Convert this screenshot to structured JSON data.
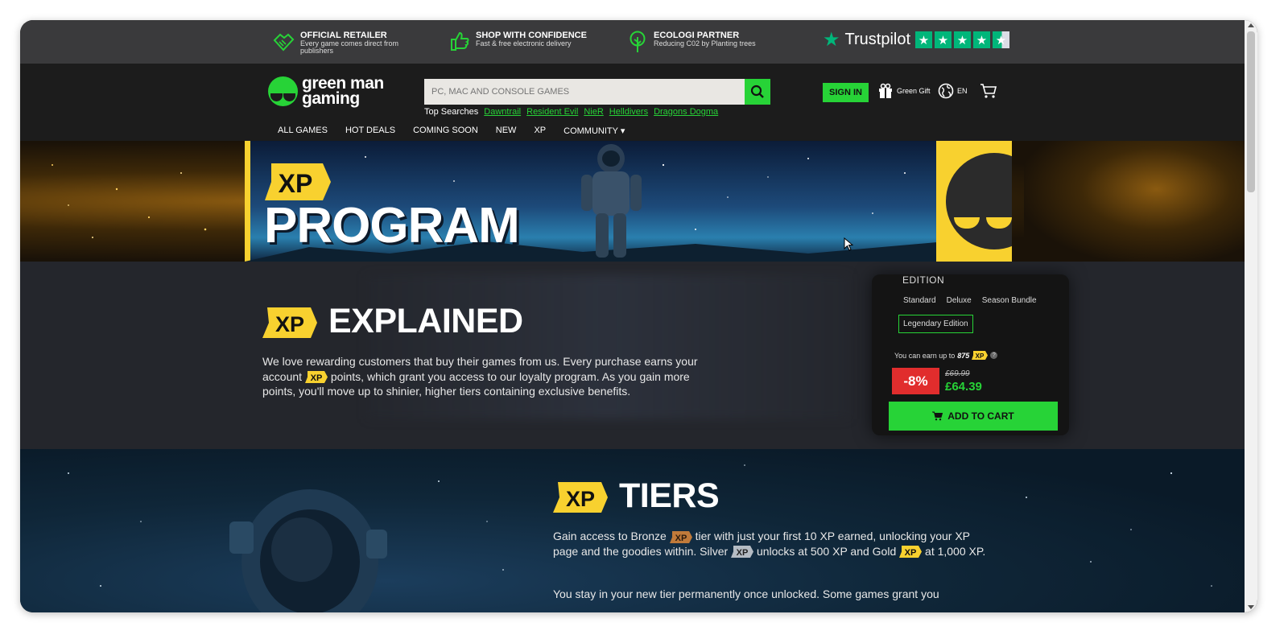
{
  "trustbar": {
    "items": [
      {
        "title": "OFFICIAL RETAILER",
        "sub": "Every game comes direct from publishers",
        "icon": "handshake-icon"
      },
      {
        "title": "SHOP WITH CONFIDENCE",
        "sub": "Fast & free electronic delivery",
        "icon": "thumbs-up-icon"
      },
      {
        "title": "ECOLOGI PARTNER",
        "sub": "Reducing C02 by Planting trees",
        "icon": "tree-icon"
      }
    ],
    "trustpilot": "Trustpilot",
    "trustpilot_rating": 4.5
  },
  "header": {
    "logo_line1": "green man",
    "logo_line2": "gaming",
    "search_placeholder": "PC, MAC AND CONSOLE GAMES",
    "top_searches_label": "Top Searches",
    "top_searches": [
      "Dawntrail",
      "Resident Evil",
      "NieR",
      "Helldivers",
      "Dragons Dogma"
    ],
    "signin": "SIGN IN",
    "green_gift": "Green Gift",
    "language": "EN"
  },
  "nav": [
    "ALL GAMES",
    "HOT DEALS",
    "COMING SOON",
    "NEW",
    "XP",
    "COMMUNITY ▾"
  ],
  "hero": {
    "badge": "XP",
    "title": "PROGRAM"
  },
  "explained": {
    "badge": "XP",
    "title": "EXPLAINED",
    "para_before_xp": "We love rewarding customers that buy their games from us. Every purchase earns your account",
    "inline_xp": "XP",
    "para_after_xp": "points, which grant you access to our loyalty program. As you gain more points, you'll move up to shinier, higher tiers containing exclusive benefits."
  },
  "card": {
    "edition": "EDITION",
    "options": [
      "Standard",
      "Deluxe",
      "Season Bundle"
    ],
    "selected": "Legendary Edition",
    "earn_prefix": "You can earn up to",
    "earn_value": "875",
    "earn_xp": "XP",
    "discount": "-8%",
    "old_price": "£69.99",
    "new_price": "£64.39",
    "add_to_cart": "ADD TO CART"
  },
  "tiers": {
    "badge": "XP",
    "title": "TIERS",
    "p1_a": "Gain access to Bronze",
    "p1_b": "tier with just your first 10 XP earned, unlocking your XP page and the goodies within. Silver",
    "p1_c": "unlocks at 500 XP and Gold",
    "p1_d": "at 1,000 XP.",
    "p2": "You stay in your new tier permanently once unlocked. Some games grant you",
    "tier_badge": "XP"
  },
  "colors": {
    "brand_green": "#27d337",
    "xp_yellow": "#f8d12f",
    "bronze": "#c07a3a",
    "silver": "#b5bcc4",
    "gold": "#f8d12f",
    "discount_red": "#e12d2d"
  }
}
